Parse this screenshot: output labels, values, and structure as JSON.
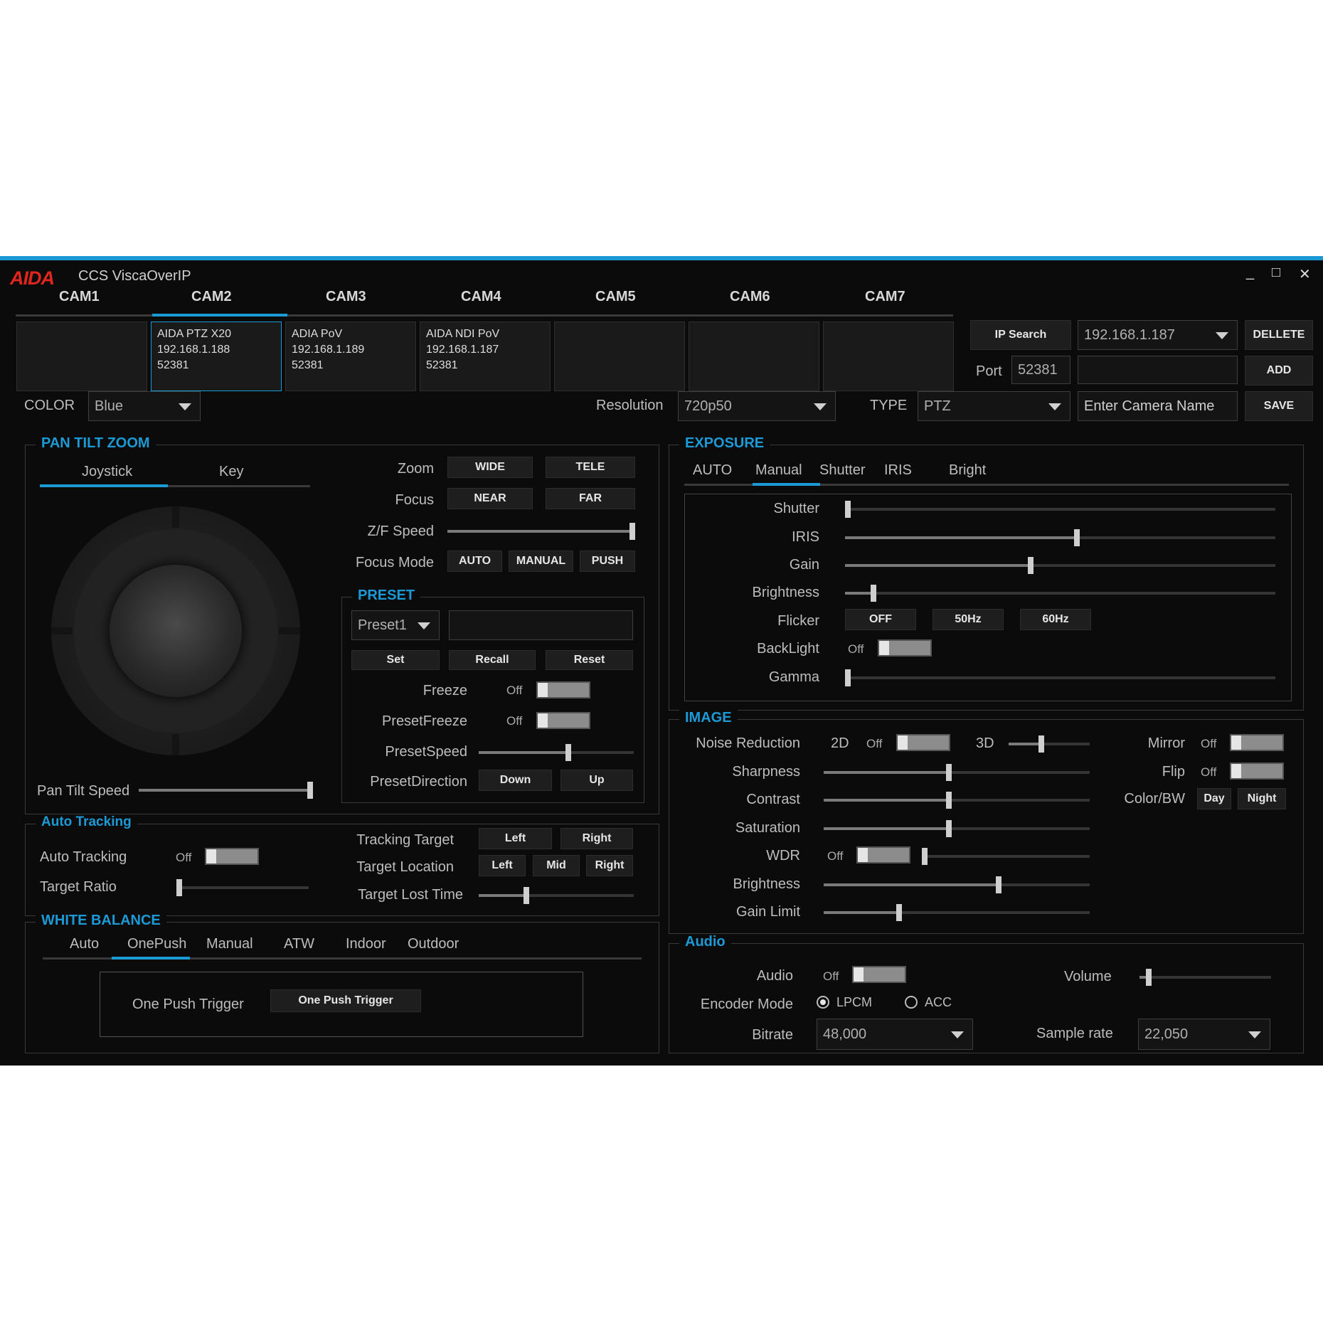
{
  "app": {
    "logo": "AIDA",
    "title": "CCS ViscaOverIP",
    "minimize": "_",
    "maximize": "□",
    "close": "✕"
  },
  "cams": {
    "tabs": [
      "CAM1",
      "CAM2",
      "CAM3",
      "CAM4",
      "CAM5",
      "CAM6",
      "CAM7"
    ],
    "active": "CAM2",
    "boxes": [
      {
        "name": "",
        "ip": "",
        "port": ""
      },
      {
        "name": "AIDA PTZ X20",
        "ip": "192.168.1.188",
        "port": "52381"
      },
      {
        "name": "ADIA PoV",
        "ip": "192.168.1.189",
        "port": "52381"
      },
      {
        "name": "AIDA NDI PoV",
        "ip": "192.168.1.187",
        "port": "52381"
      },
      {
        "name": "",
        "ip": "",
        "port": ""
      },
      {
        "name": "",
        "ip": "",
        "port": ""
      },
      {
        "name": "",
        "ip": "",
        "port": ""
      }
    ]
  },
  "top_controls": {
    "ip_search": "IP Search",
    "ip_value": "192.168.1.187",
    "delete": "DELLETE",
    "port_label": "Port",
    "port_value": "52381",
    "add": "ADD",
    "color_label": "COLOR",
    "color_value": "Blue",
    "resolution_label": "Resolution",
    "resolution_value": "720p50",
    "type_label": "TYPE",
    "type_value": "PTZ",
    "camera_name_placeholder": "Enter Camera Name",
    "save": "SAVE"
  },
  "ptz": {
    "title": "PAN TILT ZOOM",
    "tabs": [
      "Joystick",
      "Key"
    ],
    "active_tab": "Joystick",
    "zoom_label": "Zoom",
    "wide": "WIDE",
    "tele": "TELE",
    "focus_label": "Focus",
    "near": "NEAR",
    "far": "FAR",
    "zf_speed_label": "Z/F Speed",
    "zf_speed": 1.0,
    "focus_mode_label": "Focus Mode",
    "auto": "AUTO",
    "manual": "MANUAL",
    "push": "PUSH",
    "pan_tilt_speed_label": "Pan Tilt Speed",
    "pan_tilt_speed": 1.0
  },
  "preset": {
    "title": "PRESET",
    "selected": "Preset1",
    "set": "Set",
    "recall": "Recall",
    "reset": "Reset",
    "freeze_label": "Freeze",
    "freeze": "Off",
    "preset_freeze_label": "PresetFreeze",
    "preset_freeze": "Off",
    "preset_speed_label": "PresetSpeed",
    "preset_speed": 0.58,
    "direction_label": "PresetDirection",
    "down": "Down",
    "up": "Up"
  },
  "tracking": {
    "title": "Auto Tracking",
    "auto_tracking_label": "Auto Tracking",
    "auto_tracking": "Off",
    "target_ratio_label": "Target Ratio",
    "target_ratio": 0.0,
    "tracking_target_label": "Tracking Target",
    "left": "Left",
    "right": "Right",
    "target_location_label": "Target Location",
    "mid": "Mid",
    "lost_time_label": "Target Lost Time",
    "lost_time": 0.3
  },
  "white_balance": {
    "title": "WHITE BALANCE",
    "tabs": [
      "Auto",
      "OnePush",
      "Manual",
      "ATW",
      "Indoor",
      "Outdoor"
    ],
    "active_tab": "OnePush",
    "trigger_label": "One Push Trigger",
    "trigger_button": "One Push Trigger"
  },
  "exposure": {
    "title": "EXPOSURE",
    "tabs": [
      "AUTO",
      "Manual",
      "Shutter",
      "IRIS",
      "Bright"
    ],
    "active_tab": "Manual",
    "shutter_label": "Shutter",
    "shutter": 0.0,
    "iris_label": "IRIS",
    "iris": 0.54,
    "gain_label": "Gain",
    "gain": 0.43,
    "brightness_label": "Brightness",
    "brightness": 0.06,
    "flicker_label": "Flicker",
    "flicker_off": "OFF",
    "flicker_50": "50Hz",
    "flicker_60": "60Hz",
    "backlight_label": "BackLight",
    "backlight": "Off",
    "gamma_label": "Gamma",
    "gamma": 0.0
  },
  "image": {
    "title": "IMAGE",
    "nr_label": "Noise Reduction",
    "nr_2d": "2D",
    "nr_2d_state": "Off",
    "nr_3d": "3D",
    "nr_3d_level": 0.4,
    "sharpness_label": "Sharpness",
    "sharpness": 0.47,
    "contrast_label": "Contrast",
    "contrast": 0.47,
    "saturation_label": "Saturation",
    "saturation": 0.47,
    "wdr_label": "WDR",
    "wdr": "Off",
    "wdr_level": 0.0,
    "brightness_label": "Brightness",
    "brightness": 0.66,
    "gain_limit_label": "Gain Limit",
    "gain_limit": 0.28,
    "mirror_label": "Mirror",
    "mirror": "Off",
    "flip_label": "Flip",
    "flip": "Off",
    "colorbw_label": "Color/BW",
    "day": "Day",
    "night": "Night"
  },
  "audio": {
    "title": "Audio",
    "audio_label": "Audio",
    "audio": "Off",
    "volume_label": "Volume",
    "volume": 0.05,
    "encoder_label": "Encoder Mode",
    "lpcm": "LPCM",
    "acc": "ACC",
    "encoder_selected": "LPCM",
    "bitrate_label": "Bitrate",
    "bitrate": "48,000",
    "sample_rate_label": "Sample rate",
    "sample_rate": "22,050"
  }
}
